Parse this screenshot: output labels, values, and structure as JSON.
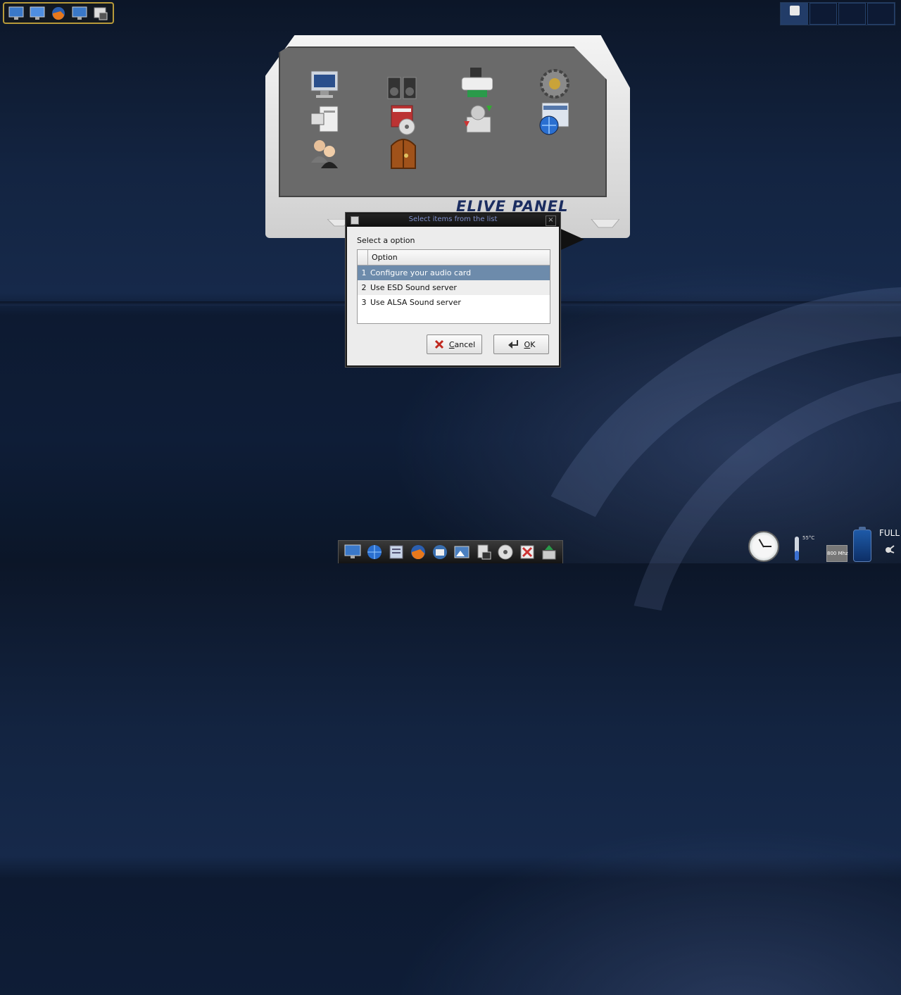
{
  "desktop": {
    "pager_count": 4
  },
  "top_launcher": {
    "items": [
      "monitor-icon",
      "monitor-icon",
      "firefox-icon",
      "monitor-icon",
      "file-manager-icon"
    ]
  },
  "elive_panel": {
    "title": "ELIVE PANEL",
    "icons": [
      "display-settings-icon",
      "speakers-icon",
      "printer-icon",
      "gear-settings-icon",
      "hardware-icon",
      "software-box-icon",
      "backup-icon",
      "network-globe-icon",
      "users-icon",
      "exit-door-icon"
    ]
  },
  "dialog": {
    "title": "Select items from the list",
    "prompt": "Select a option",
    "column_header": "Option",
    "rows": [
      {
        "num": "1",
        "text": "Configure your audio card",
        "selected": true
      },
      {
        "num": "2",
        "text": "Use ESD Sound server",
        "selected": false
      },
      {
        "num": "3",
        "text": "Use ALSA Sound server",
        "selected": false
      }
    ],
    "cancel_label": "Cancel",
    "cancel_mnemonic": "C",
    "cancel_rest": "ancel",
    "ok_mnemonic": "O",
    "ok_rest": "K"
  },
  "dock": {
    "items": [
      "monitor-icon",
      "globe-icon",
      "files-icon",
      "firefox-icon",
      "mail-icon",
      "image-editor-icon",
      "terminal-icon",
      "cd-icon",
      "tools-icon",
      "install-icon"
    ]
  },
  "tray": {
    "temperature": "55°C",
    "cpu_speed": "800 Mhz",
    "battery_status": "FULL"
  },
  "colors": {
    "selection": "#6d8bab",
    "panel_title": "#1b2d60",
    "titlebar_text": "#7f8fcc"
  }
}
